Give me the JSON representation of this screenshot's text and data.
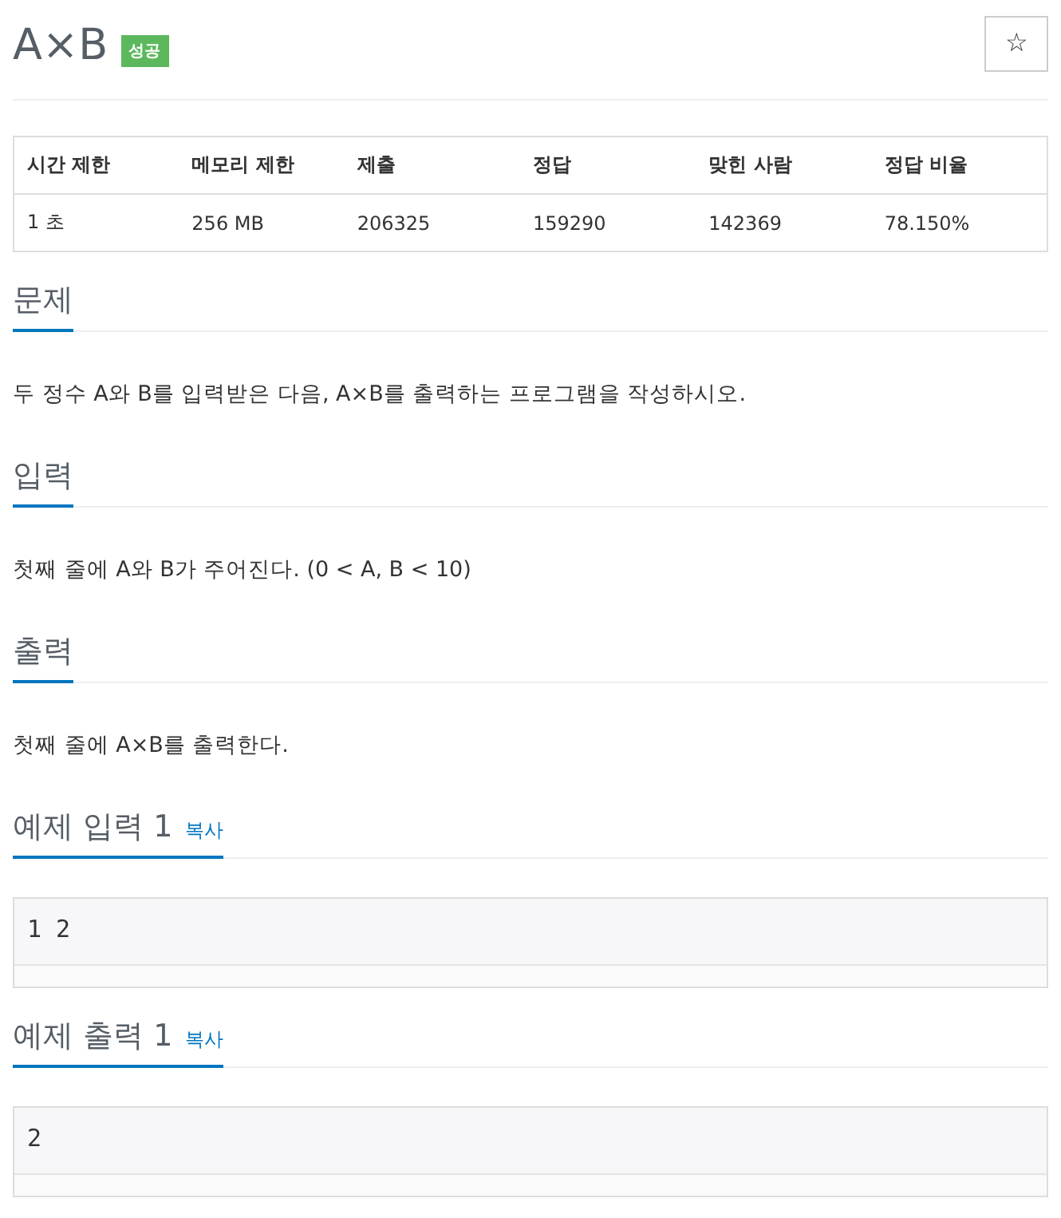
{
  "header": {
    "title": "A×B",
    "badge": "성공",
    "star_button": "☆"
  },
  "info_table": {
    "columns": [
      "시간 제한",
      "메모리 제한",
      "제출",
      "정답",
      "맞힌 사람",
      "정답 비율"
    ],
    "rows": [
      [
        "1 초",
        "256 MB",
        "206325",
        "159290",
        "142369",
        "78.150%"
      ]
    ]
  },
  "sections": [
    {
      "kind": "text",
      "heading": "문제",
      "body": "두 정수 A와 B를 입력받은 다음, A×B를 출력하는 프로그램을 작성하시오."
    },
    {
      "kind": "text",
      "heading": "입력",
      "body": "첫째 줄에 A와 B가 주어진다. (0 < A, B < 10)"
    },
    {
      "kind": "text",
      "heading": "출력",
      "body": "첫째 줄에 A×B를 출력한다."
    },
    {
      "kind": "sample",
      "heading": "예제 입력 1",
      "copy_link": "복사",
      "sample": "1 2"
    },
    {
      "kind": "sample",
      "heading": "예제 출력 1",
      "copy_link": "복사",
      "sample": "2"
    }
  ]
}
